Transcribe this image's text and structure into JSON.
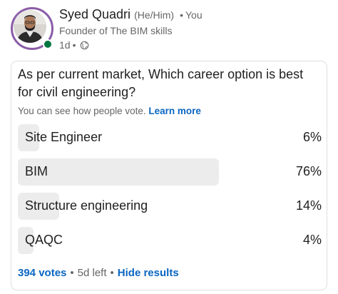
{
  "author": {
    "name": "Syed Quadri",
    "pronouns": "(He/Him)",
    "separator": "•",
    "connection": "You",
    "headline": "Founder of The BIM skills",
    "time": "1d",
    "visibility_icon": "globe-icon",
    "online": true
  },
  "poll": {
    "question": "As per current market, Which career option is best for civil engineering?",
    "visibility_text": "You can see how people vote.",
    "learn_more": "Learn more",
    "options": [
      {
        "label": "Site Engineer",
        "percent_text": "6%",
        "share": 6
      },
      {
        "label": "BIM",
        "percent_text": "76%",
        "share": 76
      },
      {
        "label": "Structure engineering",
        "percent_text": "14%",
        "share": 14
      },
      {
        "label": "QAQC",
        "percent_text": "4%",
        "share": 4
      }
    ],
    "votes": "394 votes",
    "time_left": "5d left",
    "hide_results": "Hide results",
    "separator": "•"
  },
  "colors": {
    "link": "#0a66c2",
    "bar": "#ececec",
    "online": "#057642",
    "avatar_ring": "#8a5ca8"
  }
}
